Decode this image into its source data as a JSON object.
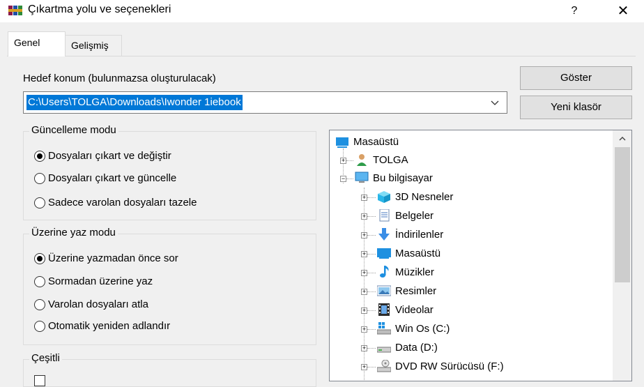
{
  "window": {
    "title": "Çıkartma yolu ve seçenekleri",
    "help_label": "?",
    "close_label": "✕"
  },
  "tabs": [
    {
      "label": "Genel",
      "active": true
    },
    {
      "label": "Gelişmiş",
      "active": false
    }
  ],
  "target": {
    "label": "Hedef konum (bulunmazsa oluşturulacak)",
    "value": "C:\\Users\\TOLGA\\Downloads\\Iwonder 1iebook",
    "dropdown_icon": "chevron-down-icon"
  },
  "buttons": {
    "show": "Göster",
    "new_folder": "Yeni klasör"
  },
  "update_mode": {
    "legend": "Güncelleme modu",
    "options": [
      {
        "label": "Dosyaları çıkart ve değiştir",
        "selected": true
      },
      {
        "label": "Dosyaları çıkart ve güncelle",
        "selected": false
      },
      {
        "label": "Sadece varolan dosyaları tazele",
        "selected": false
      }
    ]
  },
  "overwrite_mode": {
    "legend": "Üzerine yaz modu",
    "options": [
      {
        "label": "Üzerine yazmadan önce sor",
        "selected": true
      },
      {
        "label": "Sormadan üzerine yaz",
        "selected": false
      },
      {
        "label": "Varolan dosyaları atla",
        "selected": false
      },
      {
        "label": "Otomatik yeniden adlandır",
        "selected": false
      }
    ]
  },
  "misc": {
    "legend": "Çeşitli"
  },
  "tree": {
    "root": {
      "label": "Masaüstü",
      "icon": "desktop-icon"
    },
    "items": [
      {
        "label": "TOLGA",
        "icon": "user-icon",
        "expander": "+"
      },
      {
        "label": "Bu bilgisayar",
        "icon": "computer-icon",
        "expander": "−"
      },
      {
        "label": "3D Nesneler",
        "icon": "cube-icon",
        "expander": "+"
      },
      {
        "label": "Belgeler",
        "icon": "document-icon",
        "expander": "+"
      },
      {
        "label": "İndirilenler",
        "icon": "download-icon",
        "expander": "+"
      },
      {
        "label": "Masaüstü",
        "icon": "desktop-icon",
        "expander": "+"
      },
      {
        "label": "Müzikler",
        "icon": "music-icon",
        "expander": "+"
      },
      {
        "label": "Resimler",
        "icon": "image-icon",
        "expander": "+"
      },
      {
        "label": "Videolar",
        "icon": "film-icon",
        "expander": "+"
      },
      {
        "label": "Win Os (C:)",
        "icon": "system-drive-icon",
        "expander": "+"
      },
      {
        "label": "Data (D:)",
        "icon": "drive-icon",
        "expander": "+"
      },
      {
        "label": "DVD RW Sürücüsü (F:)",
        "icon": "dvd-drive-icon",
        "expander": "+"
      }
    ]
  },
  "colors": {
    "selection": "#0078d7",
    "dialog_bg": "#f0f0f0"
  }
}
